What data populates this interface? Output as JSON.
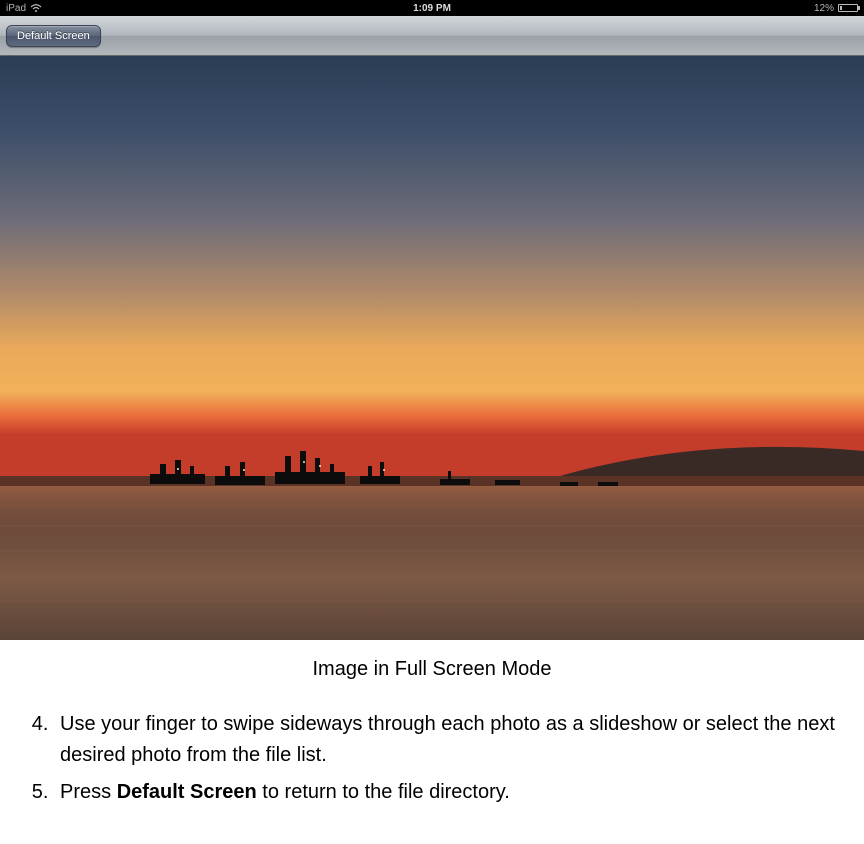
{
  "status_bar": {
    "device": "iPad",
    "time": "1:09 PM",
    "battery_percent": "12%"
  },
  "toolbar": {
    "default_screen_label": "Default Screen"
  },
  "caption": "Image in Full Screen Mode",
  "instructions": {
    "step4_prefix": "Use your finger to swipe sideways through each photo as a slideshow or select the next desired photo from the file list.",
    "step5_prefix": "Press ",
    "step5_bold": "Default Screen",
    "step5_suffix": " to return to the file directory."
  }
}
